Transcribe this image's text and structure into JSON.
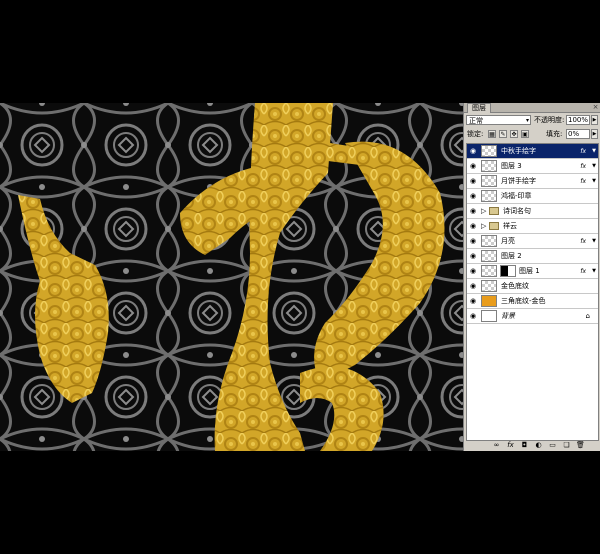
{
  "panel": {
    "tab_label": "图层",
    "close_glyph": "×",
    "blend_mode": "正常",
    "opacity_label": "不透明度:",
    "opacity_value": "100%",
    "lock_label": "锁定:",
    "fill_label": "填充:",
    "fill_value": "0%",
    "fx_label": "fx"
  },
  "layers": [
    {
      "name": "中秋手绘字",
      "selected": true,
      "fx": true,
      "thumb": "transparent"
    },
    {
      "name": "图层 3",
      "selected": false,
      "fx": true,
      "thumb": "transparent"
    },
    {
      "name": "月饼手绘字",
      "selected": false,
      "fx": true,
      "thumb": "transparent"
    },
    {
      "name": "鸿福-印章",
      "selected": false,
      "fx": false,
      "thumb": "transparent"
    },
    {
      "name": "诗词名句",
      "selected": false,
      "fx": false,
      "thumb": "group"
    },
    {
      "name": "祥云",
      "selected": false,
      "fx": false,
      "thumb": "group"
    },
    {
      "name": "月亮",
      "selected": false,
      "fx": true,
      "thumb": "transparent"
    },
    {
      "name": "图层 2",
      "selected": false,
      "fx": false,
      "thumb": "transparent"
    },
    {
      "name": "图层 1",
      "selected": false,
      "fx": true,
      "thumb": "mask"
    },
    {
      "name": "金色底纹",
      "selected": false,
      "fx": false,
      "thumb": "transparent"
    },
    {
      "name": "三角底纹-金色",
      "selected": false,
      "fx": false,
      "thumb": "orange"
    },
    {
      "name": "背景",
      "selected": false,
      "fx": false,
      "thumb": "white"
    }
  ],
  "footer_icons": [
    "link-icon",
    "fx-icon",
    "mask-icon",
    "adjustment-icon",
    "folder-icon",
    "new-layer-icon",
    "trash-icon"
  ],
  "colors": {
    "gold": "#d4aa2a",
    "pattern": "#8c8c8c",
    "selection": "#0a246a"
  }
}
